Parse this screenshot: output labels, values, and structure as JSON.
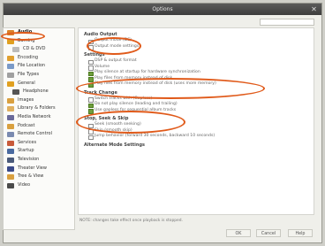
{
  "window": {
    "title": "Options",
    "close_glyph": "✕"
  },
  "sidebar": {
    "items": [
      {
        "label": "Audio",
        "icon": "speaker-icon",
        "color": "#d9822b"
      },
      {
        "label": "Burning",
        "icon": "disc-burn-icon",
        "color": "#e0a020"
      },
      {
        "label": "CD & DVD",
        "icon": "cd-icon",
        "color": "#bbbbbb"
      },
      {
        "label": "Encoding",
        "icon": "encoding-icon",
        "color": "#e0a030"
      },
      {
        "label": "File Location",
        "icon": "file-location-icon",
        "color": "#7a9ac8"
      },
      {
        "label": "File Types",
        "icon": "file-types-icon",
        "color": "#a0a0a0"
      },
      {
        "label": "General",
        "icon": "general-icon",
        "color": "#e0a020"
      },
      {
        "label": "Headphone",
        "icon": "headphone-icon",
        "color": "#555555"
      },
      {
        "label": "Images",
        "icon": "images-icon",
        "color": "#d9a040"
      },
      {
        "label": "Library & Folders",
        "icon": "library-icon",
        "color": "#e0b060"
      },
      {
        "label": "Media Network",
        "icon": "media-network-icon",
        "color": "#6a6a9a"
      },
      {
        "label": "Podcast",
        "icon": "podcast-icon",
        "color": "#d9a040"
      },
      {
        "label": "Remote Control",
        "icon": "remote-control-icon",
        "color": "#7a8ab0"
      },
      {
        "label": "Services",
        "icon": "services-icon",
        "color": "#c85a3a"
      },
      {
        "label": "Startup",
        "icon": "startup-icon",
        "color": "#4a6aa0"
      },
      {
        "label": "Television",
        "icon": "television-icon",
        "color": "#4a5a7a"
      },
      {
        "label": "Theater View",
        "icon": "theater-view-icon",
        "color": "#3a4a8a"
      },
      {
        "label": "Tree & View",
        "icon": "tree-view-icon",
        "color": "#d9a040"
      },
      {
        "label": "Video",
        "icon": "video-icon",
        "color": "#4a4a4a"
      }
    ]
  },
  "content": {
    "sections": [
      {
        "title": "Audio Output",
        "options": [
          {
            "label": "Output mode (DS)",
            "checked": false
          },
          {
            "label": "Output mode settings",
            "checked": false
          }
        ]
      },
      {
        "title": "Settings",
        "options": [
          {
            "label": "DSP & output format",
            "checked": false
          },
          {
            "label": "Volume",
            "checked": false
          },
          {
            "label": "Play silence at startup for hardware synchronization",
            "checked": true
          },
          {
            "label": "Play files from memory instead of disk",
            "checked": true
          },
          {
            "label": "Play files from memory instead of disk (uses more memory)",
            "checked": true
          }
        ]
      },
      {
        "title": "Track Change",
        "options": [
          {
            "label": "Switch tracks with (Gapless)",
            "checked": false
          },
          {
            "label": "Do not play silence (leading and trailing)",
            "checked": true
          },
          {
            "label": "Use gapless for sequential album tracks",
            "checked": true
          }
        ]
      },
      {
        "title": "Stop, Seek & Skip",
        "options": [
          {
            "label": "Seek (smooth seeking)",
            "checked": false
          },
          {
            "label": "Skip (smooth skip)",
            "checked": false
          },
          {
            "label": "Jump behavior (forward 30 seconds, backward 10 seconds)",
            "checked": false
          }
        ]
      },
      {
        "title": "Alternate Mode Settings",
        "options": []
      }
    ]
  },
  "footer": {
    "note": "NOTE: changes take effect once playback is stopped.",
    "ok_label": "OK",
    "cancel_label": "Cancel",
    "help_label": "Help"
  }
}
